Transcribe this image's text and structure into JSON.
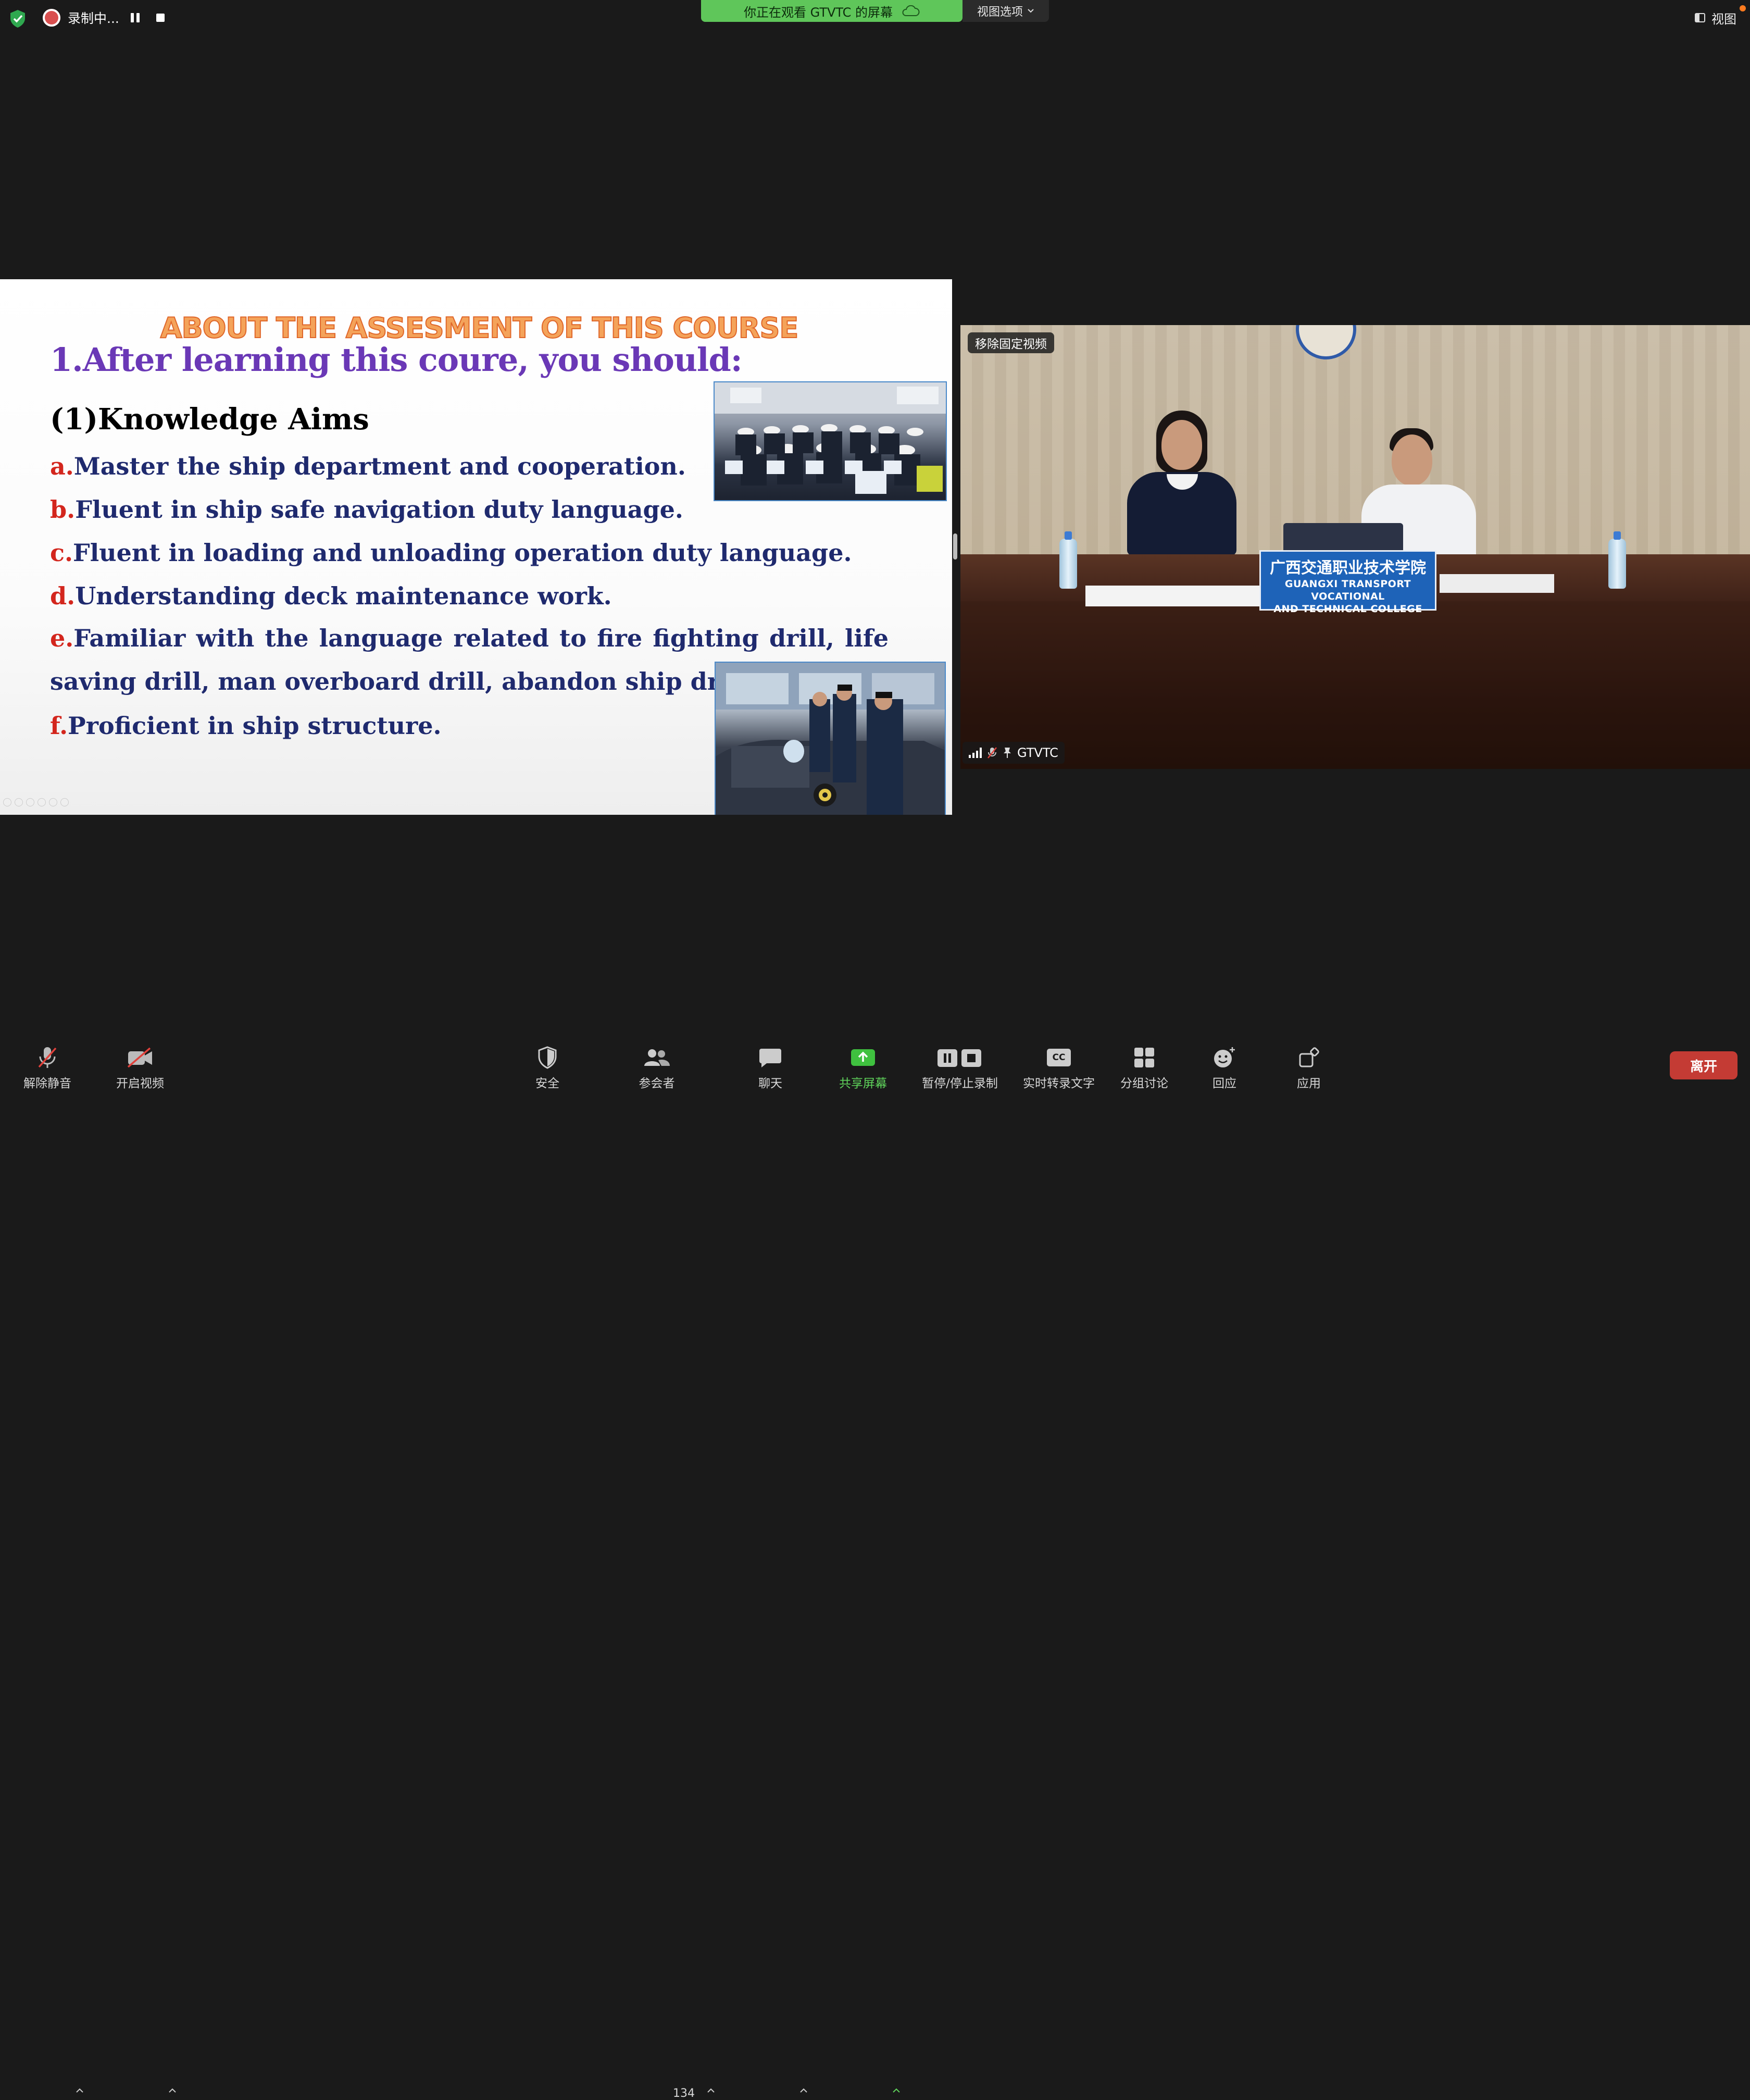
{
  "top_bar": {
    "recording_label": "录制中...",
    "sharing_banner": "你正在观看 GTVTC 的屏幕",
    "view_options_label": "视图选项",
    "view_button_label": "视图"
  },
  "slide": {
    "heading": "ABOUT THE ASSESMENT OF THIS COURSE",
    "subheading": "1.After learning this coure, you should:",
    "section_title": "(1)Knowledge Aims",
    "aims": [
      {
        "letter": "a.",
        "text": "Master the ship department and cooperation."
      },
      {
        "letter": "b.",
        "text": "Fluent in ship safe navigation duty language."
      },
      {
        "letter": "c.",
        "text": "Fluent in loading and unloading operation duty language."
      },
      {
        "letter": "d.",
        "text": "Understanding deck maintenance work."
      },
      {
        "letter": "e.",
        "text": "Familiar with the language related to fire fighting drill, life saving drill, man overboard drill, abandon ship drill."
      },
      {
        "letter": "f.",
        "text": "Proficient in ship structure."
      }
    ]
  },
  "video": {
    "unpin_label": "移除固定视频",
    "participant_name": "GTVTC",
    "nameplate_cn": "广西交通职业技术学院",
    "nameplate_en_line1": "GUANGXI TRANSPORT VOCATIONAL",
    "nameplate_en_line2": "AND TECHNICAL COLLEGE"
  },
  "toolbar": {
    "unmute": "解除静音",
    "start_video": "开启视频",
    "security": "安全",
    "participants": "参会者",
    "participants_count": "134",
    "chat": "聊天",
    "share_screen": "共享屏幕",
    "pause_stop_recording": "暂停/停止录制",
    "live_transcript": "实时转录文字",
    "breakout_rooms": "分组讨论",
    "reactions": "回应",
    "apps": "应用",
    "leave": "离开",
    "cc_badge": "CC"
  },
  "colors": {
    "share_green": "#5fc65a",
    "leave_red": "#c43b34",
    "aim_letter_red": "#d3261d",
    "aim_text_navy": "#1f2a6e",
    "subheading_purple": "#6a38b6"
  }
}
